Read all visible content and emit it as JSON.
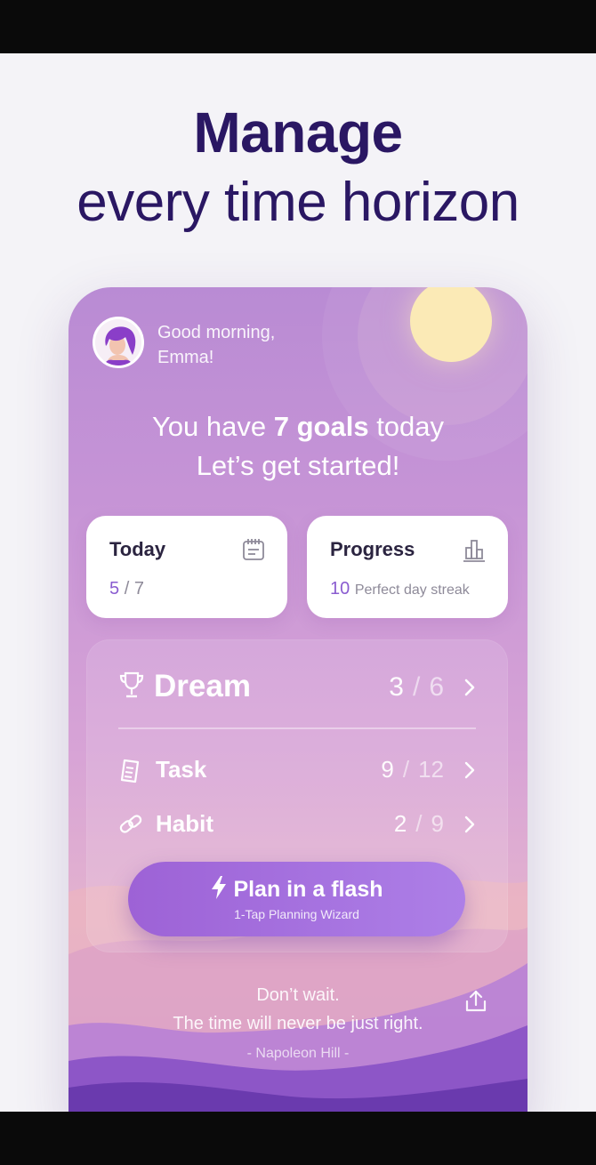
{
  "headline": {
    "bold": "Manage",
    "light": "every time horizon"
  },
  "app": {
    "greeting": {
      "line1": "Good morning,",
      "line2": "Emma!"
    },
    "goals": {
      "prefix": "You have",
      "count_text": "7 goals",
      "suffix": "today"
    },
    "subtitle": "Let’s get started!",
    "cards": {
      "today": {
        "title": "Today",
        "value": "5",
        "separator": "/",
        "total": "7",
        "icon": "calendar-icon"
      },
      "progress": {
        "title": "Progress",
        "value": "10",
        "caption": "Perfect day streak",
        "icon": "bar-chart-icon"
      }
    },
    "rows": {
      "dream": {
        "label": "Dream",
        "done": "3",
        "separator": "/",
        "total": "6",
        "icon": "trophy-icon"
      },
      "task": {
        "label": "Task",
        "done": "9",
        "separator": "/",
        "total": "12",
        "icon": "checklist-icon"
      },
      "habit": {
        "label": "Habit",
        "done": "2",
        "separator": "/",
        "total": "9",
        "icon": "link-icon"
      }
    },
    "flash_button": {
      "label": "Plan in a flash",
      "sub": "1-Tap Planning Wizard",
      "icon": "lightning-icon"
    },
    "quote": {
      "line1": "Don’t wait.",
      "line2": "The time will never be just right.",
      "author": "- Napoleon Hill -"
    }
  },
  "colors": {
    "headline": "#2a1763",
    "accent": "#8a5cd0",
    "button_start": "#9d62d6",
    "button_end": "#ad7fe7",
    "sun": "#fbeab6"
  }
}
